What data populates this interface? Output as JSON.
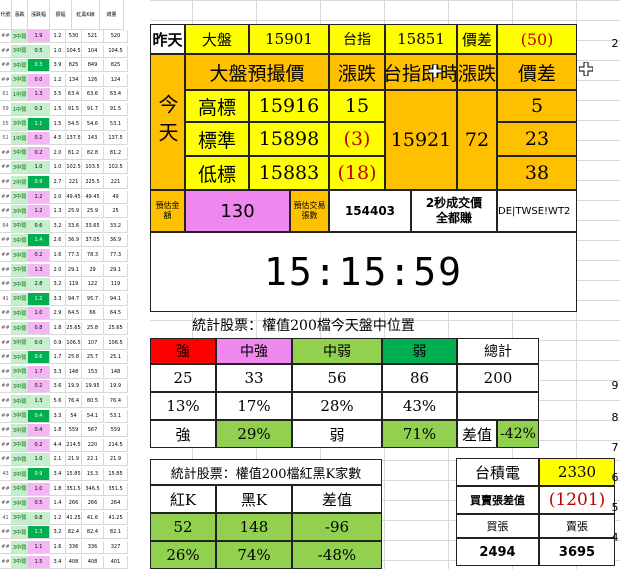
{
  "left_grid": {
    "headers": [
      "代號",
      "漲跌",
      "漲跌幅",
      "振幅",
      "紅黑K線",
      "總量"
    ],
    "rows": [
      [
        "##",
        "3中弱",
        "1.9",
        "1.2",
        "530",
        "521",
        "520"
      ],
      [
        "##",
        "3中弱",
        "0.5",
        "1.0",
        "104.5",
        "104",
        "104.5"
      ],
      [
        "##",
        "3中弱",
        "0.3",
        "3.9",
        "825",
        "849",
        "825"
      ],
      [
        "##",
        "3中弱",
        "0.0",
        "1.2",
        "134",
        "126",
        "124"
      ],
      [
        "61",
        "1中弱",
        "1.3",
        "3.5",
        "63.4",
        "63.6",
        "63.4"
      ],
      [
        "59",
        "1中弱",
        "0.3",
        "1.5",
        "91.5",
        "91.7",
        "91.5"
      ],
      [
        "55",
        "3中弱",
        "1.1",
        "1.5",
        "54.5",
        "54.6",
        "53.1"
      ],
      [
        "51",
        "1中弱",
        "0.2",
        "4.5",
        "137.5",
        "143",
        "137.5"
      ],
      [
        "##",
        "3中弱",
        "0.2",
        "2.0",
        "81.2",
        "82.8",
        "81.2"
      ],
      [
        "##",
        "3中弱",
        "1.0",
        "1.0",
        "102.5",
        "103.5",
        "102.5"
      ],
      [
        "##",
        "2中弱",
        "0.9",
        "2.7",
        "221",
        "225.5",
        "221"
      ],
      [
        "##",
        "3中弱",
        "1.2",
        "2.0",
        "49.45",
        "49.45",
        "49"
      ],
      [
        "##",
        "3中弱",
        "1.2",
        "1.3",
        "25.9",
        "25.9",
        "25"
      ],
      [
        "64",
        "3中弱",
        "0.6",
        "3.2",
        "33.6",
        "33.65",
        "33.2"
      ],
      [
        "##",
        "3中弱",
        "1.4",
        "2.6",
        "36.9",
        "37.05",
        "36.9"
      ],
      [
        "##",
        "3中弱",
        "0.2",
        "1.6",
        "77.3",
        "78.3",
        "77.3"
      ],
      [
        "##",
        "3中弱",
        "1.3",
        "2.0",
        "29.1",
        "29",
        "29.1"
      ],
      [
        "##",
        "3中弱",
        "2.8",
        "3.2",
        "119",
        "122",
        "119"
      ],
      [
        "41",
        "3中弱",
        "1.2",
        "3.3",
        "94.7",
        "95.7",
        "94.1"
      ],
      [
        "##",
        "3中弱",
        "1.0",
        "2.9",
        "64.5",
        "66",
        "64.5"
      ],
      [
        "##",
        "3中弱",
        "0.8",
        "1.8",
        "25.65",
        "25.8",
        "25.65"
      ],
      [
        "##",
        "3中弱",
        "0.0",
        "0.9",
        "106.5",
        "107",
        "106.5"
      ],
      [
        "##",
        "3中弱",
        "0.6",
        "1.7",
        "25.8",
        "25.7",
        "25.1"
      ],
      [
        "##",
        "3中弱",
        "1.7",
        "3.3",
        "148",
        "153",
        "148"
      ],
      [
        "##",
        "3中弱",
        "0.2",
        "3.6",
        "19.9",
        "19.95",
        "19.9"
      ],
      [
        "##",
        "3中弱",
        "1.3",
        "5.6",
        "76.4",
        "80.5",
        "76.4"
      ],
      [
        "##",
        "3中弱",
        "0.4",
        "3.3",
        "54",
        "54.1",
        "53.1"
      ],
      [
        "##",
        "3中弱",
        "0.4",
        "1.8",
        "559",
        "567",
        "559"
      ],
      [
        "##",
        "3中弱",
        "0.2",
        "4.4",
        "214.5",
        "220",
        "214.5"
      ],
      [
        "##",
        "3中弱",
        "1.0",
        "2.1",
        "21.9",
        "22.1",
        "21.9"
      ],
      [
        "43",
        "3中弱",
        "0.9",
        "3.4",
        "15.85",
        "15.3",
        "15.85"
      ],
      [
        "##",
        "3中弱",
        "1.0",
        "1.8",
        "351.5",
        "346.5",
        "351.5"
      ],
      [
        "##",
        "3中弱",
        "0.5",
        "1.4",
        "266",
        "266",
        "264"
      ],
      [
        "41",
        "3中弱",
        "0.8",
        "1.2",
        "41.25",
        "41.6",
        "41.25"
      ],
      [
        "##",
        "3中弱",
        "1.3",
        "3.2",
        "82.4",
        "82.4",
        "82.1"
      ],
      [
        "##",
        "3中弱",
        "1.1",
        "1.6",
        "336",
        "336",
        "327"
      ],
      [
        "##",
        "3中弱",
        "1.5",
        "3.4",
        "408",
        "408",
        "401"
      ]
    ]
  },
  "top": {
    "yesterday_label": "昨天",
    "big_label": "大盤",
    "big_value": "15901",
    "taiex_label": "台指",
    "taiex_value": "15851",
    "diff_label": "價差",
    "diff_value": "(50)",
    "forecast_title": "大盤預撮價",
    "change_title": "漲跌",
    "realtime_title": "台指即時",
    "realtime_change_title": "漲跌",
    "spread_title": "價差",
    "today_label": "今天",
    "high_label": "高標",
    "high_value": "15916",
    "high_change": "15",
    "std_label": "標準",
    "std_value": "15898",
    "std_change": "(3)",
    "low_label": "低標",
    "low_value": "15883",
    "low_change": "(18)",
    "realtime_value": "15921",
    "realtime_change": "72",
    "spread_high": "5",
    "spread_std": "23",
    "spread_low": "38"
  },
  "mid": {
    "est_amount_label": "預估金額",
    "est_amount_value": "130",
    "est_trades_label": "預估交易張數",
    "est_trades_value": "154403",
    "twosec_label": "2秒成交價全都賺",
    "dde_text": "DE|TWSE!WT2",
    "clock": "15:15:59"
  },
  "stats": {
    "title": "統計股票：權值200檔今天盤中位置",
    "headers": [
      "強",
      "中強",
      "中弱",
      "弱",
      "總計"
    ],
    "counts": [
      "25",
      "33",
      "56",
      "86",
      "200"
    ],
    "pcts": [
      "13%",
      "17%",
      "28%",
      "43%"
    ],
    "bottom": [
      "強",
      "29%",
      "弱",
      "71%",
      "差值",
      "-42%"
    ]
  },
  "redblack": {
    "title": "統計股票：權值200檔紅黑K家數",
    "headers": [
      "紅K",
      "黑K",
      "差值"
    ],
    "counts": [
      "52",
      "148",
      "-96"
    ],
    "pcts": [
      "26%",
      "74%",
      "-48%"
    ]
  },
  "tsmc": {
    "name": "台積電",
    "price": "2330",
    "diff_label": "買賣張差值",
    "diff_value": "(1201)",
    "buy_label": "買張",
    "sell_label": "賣張",
    "buy_value": "2494",
    "sell_value": "3695"
  },
  "right_edge": {
    "row_labels": [
      "2",
      "9",
      "8",
      "7",
      "6",
      "5",
      "4"
    ]
  },
  "colors": {
    "yellow": "#ffff00",
    "orange": "#ffc000",
    "pink": "#ee88ee",
    "red": "#ff0000",
    "green": "#00b050",
    "light_green": "#92d050"
  }
}
